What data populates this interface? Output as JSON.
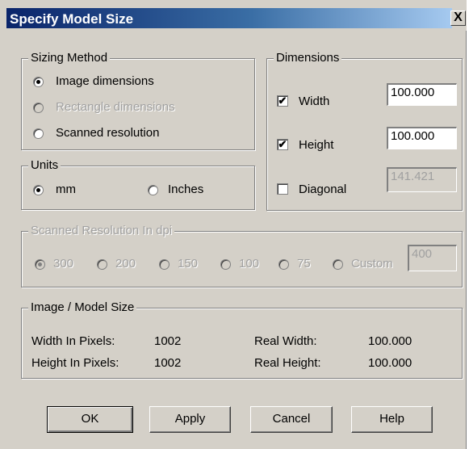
{
  "window": {
    "title": "Specify Model Size",
    "close_glyph": "X"
  },
  "sizing_method": {
    "legend": "Sizing Method",
    "options": [
      {
        "label": "Image dimensions",
        "checked": true,
        "enabled": true
      },
      {
        "label": "Rectangle dimensions",
        "checked": false,
        "enabled": false
      },
      {
        "label": "Scanned resolution",
        "checked": false,
        "enabled": true
      }
    ]
  },
  "units": {
    "legend": "Units",
    "options": [
      {
        "label": "mm",
        "checked": true
      },
      {
        "label": "Inches",
        "checked": false
      }
    ]
  },
  "dimensions": {
    "legend": "Dimensions",
    "width": {
      "label": "Width",
      "checked": true,
      "value": "100.000"
    },
    "height": {
      "label": "Height",
      "checked": true,
      "value": "100.000"
    },
    "diagonal": {
      "label": "Diagonal",
      "checked": false,
      "value": "141.421"
    }
  },
  "scanned_resolution": {
    "legend": "Scanned Resolution In dpi",
    "options": [
      {
        "label": "300",
        "checked": true
      },
      {
        "label": "200",
        "checked": false
      },
      {
        "label": "150",
        "checked": false
      },
      {
        "label": "100",
        "checked": false
      },
      {
        "label": "75",
        "checked": false
      },
      {
        "label": "Custom",
        "checked": false
      }
    ],
    "custom_value": "400"
  },
  "model_size": {
    "legend": "Image / Model Size",
    "width_pixels_label": "Width In Pixels:",
    "width_pixels_value": "1002",
    "height_pixels_label": "Height In Pixels:",
    "height_pixels_value": "1002",
    "real_width_label": "Real Width:",
    "real_width_value": "100.000",
    "real_height_label": "Real Height:",
    "real_height_value": "100.000"
  },
  "buttons": {
    "ok": "OK",
    "apply": "Apply",
    "cancel": "Cancel",
    "help": "Help"
  },
  "colors": {
    "dialog_face": "#d4d0c8",
    "title_gradient_start": "#0a246a",
    "title_gradient_end": "#a6caf0",
    "disabled_text": "#a0a0a0"
  },
  "icons": {
    "close": "close-icon",
    "check": "checkmark-icon"
  }
}
